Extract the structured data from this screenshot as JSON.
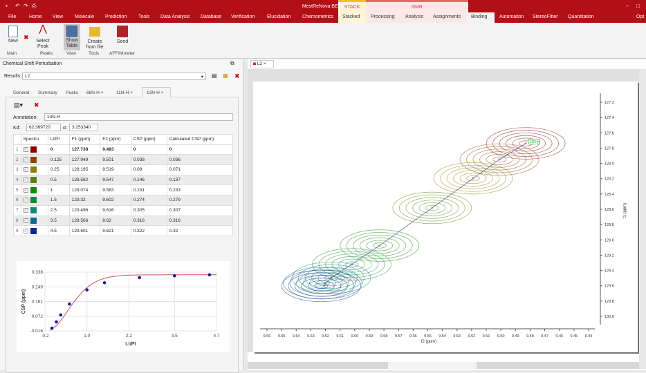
{
  "app": {
    "title": "MestReNova BETA",
    "context_stack": "STACK",
    "context_nmr": "NMR"
  },
  "menu": [
    "File",
    "Home",
    "View",
    "Molecule",
    "Prediction",
    "Tools",
    "Data Analysis",
    "Database",
    "Verification",
    "Elucidation",
    "Chemometrics",
    "Stacked",
    "Processing",
    "Analysis",
    "Assignments",
    "Binding",
    "Automation",
    "StereoFitter",
    "Quantitation",
    "Opt"
  ],
  "ribbon": {
    "buttons": [
      {
        "label": "New"
      },
      {
        "label": "Select Peak"
      },
      {
        "label": "Show Table"
      },
      {
        "label": "Create from file"
      },
      {
        "label": "Send"
      }
    ],
    "groups": [
      "Main",
      "Peaks",
      "View",
      "Tools",
      "AFFINImeter"
    ]
  },
  "panel": {
    "title": "Chemical Shift Perturbation",
    "results_label": "Results:",
    "results_value": "L2",
    "tabs": [
      "General",
      "Summary",
      "Peaks",
      "68N-H",
      "11N-H",
      "13N-H"
    ],
    "active_tab": "13N-H",
    "annotation_label": "Annotation:",
    "annotation_value": "13N-H",
    "kd_label": "Kd:",
    "kd_value": "62.369720",
    "alpha_label": "α:",
    "alpha_value": "3.253340",
    "columns": [
      "",
      "Spectru",
      "Lt/Pt",
      "F1 (ppm)",
      "F2 (ppm)",
      "CSP (ppm)",
      "Calculated CSP (ppm)"
    ],
    "rows": [
      {
        "n": "1",
        "color": "#8b0000",
        "lt": "0",
        "f1": "127.738",
        "f2": "9.483",
        "csp": "0",
        "calc": "0"
      },
      {
        "n": "2",
        "color": "#8b4500",
        "lt": "0.125",
        "f1": "127.949",
        "f2": "9.501",
        "csp": "0.038",
        "calc": "0.036"
      },
      {
        "n": "3",
        "color": "#8b8000",
        "lt": "0.25",
        "f1": "128.195",
        "f2": "9.519",
        "csp": "0.08",
        "calc": "0.071"
      },
      {
        "n": "4",
        "color": "#5a8000",
        "lt": "0.5",
        "f1": "128.582",
        "f2": "9.547",
        "csp": "0.146",
        "calc": "0.137"
      },
      {
        "n": "5",
        "color": "#138a00",
        "lt": "1",
        "f1": "129.074",
        "f2": "9.583",
        "csp": "0.231",
        "calc": "0.233"
      },
      {
        "n": "6",
        "color": "#0f8a3a",
        "lt": "1.5",
        "f1": "129.32",
        "f2": "9.602",
        "csp": "0.274",
        "calc": "0.279"
      },
      {
        "n": "7",
        "color": "#0f8a70",
        "lt": "2.5",
        "f1": "129.496",
        "f2": "9.616",
        "csp": "0.305",
        "calc": "0.307"
      },
      {
        "n": "8",
        "color": "#0f6a8a",
        "lt": "3.5",
        "f1": "129.566",
        "f2": "9.62",
        "csp": "0.316",
        "calc": "0.316"
      },
      {
        "n": "9",
        "color": "#0a2a8a",
        "lt": "4.5",
        "f1": "129.601",
        "f2": "9.621",
        "csp": "0.322",
        "calc": "0.32"
      }
    ]
  },
  "chart_data": [
    {
      "type": "scatter",
      "xlabel": "Lt/Pt",
      "ylabel": "CSP (ppm)",
      "xlim": [
        -0.2,
        4.7
      ],
      "ylim": [
        -0.016,
        0.338
      ],
      "xticks": [
        "-0.2",
        "1.0",
        "2.2",
        "3.5",
        "4.7"
      ],
      "yticks": [
        "-0.016",
        "0.072",
        "0.161",
        "0.249",
        "0.338"
      ],
      "grid": true,
      "x": [
        0,
        0.125,
        0.25,
        0.5,
        1,
        1.5,
        2.5,
        3.5,
        4.5
      ],
      "y": [
        0,
        0.038,
        0.08,
        0.146,
        0.231,
        0.274,
        0.305,
        0.316,
        0.322
      ],
      "fit_y": [
        0,
        0.036,
        0.071,
        0.137,
        0.233,
        0.279,
        0.307,
        0.316,
        0.32
      ],
      "point_color": "#1a1aa0",
      "fit_color": "#d05050"
    },
    {
      "type": "contour",
      "document_tab": "L2",
      "xlabel": "f2 (ppm)",
      "ylabel": "f1 (ppm)",
      "xlim": [
        9.66,
        9.44
      ],
      "ylim": [
        127.2,
        130.0
      ],
      "xticks": [
        "9.66",
        "9.65",
        "9.64",
        "9.63",
        "9.62",
        "9.61",
        "9.60",
        "9.59",
        "9.58",
        "9.57",
        "9.56",
        "9.55",
        "9.54",
        "9.53",
        "9.52",
        "9.51",
        "9.50",
        "9.49",
        "9.48",
        "9.47",
        "9.46",
        "9.45",
        "9.44"
      ],
      "yticks": [
        "127.2",
        "127.4",
        "127.6",
        "127.8",
        "128.0",
        "128.2",
        "128.4",
        "128.6",
        "128.8",
        "129.0",
        "129.2",
        "129.4",
        "129.6",
        "129.8",
        "130.0"
      ],
      "peak_label": "13N-H"
    }
  ]
}
